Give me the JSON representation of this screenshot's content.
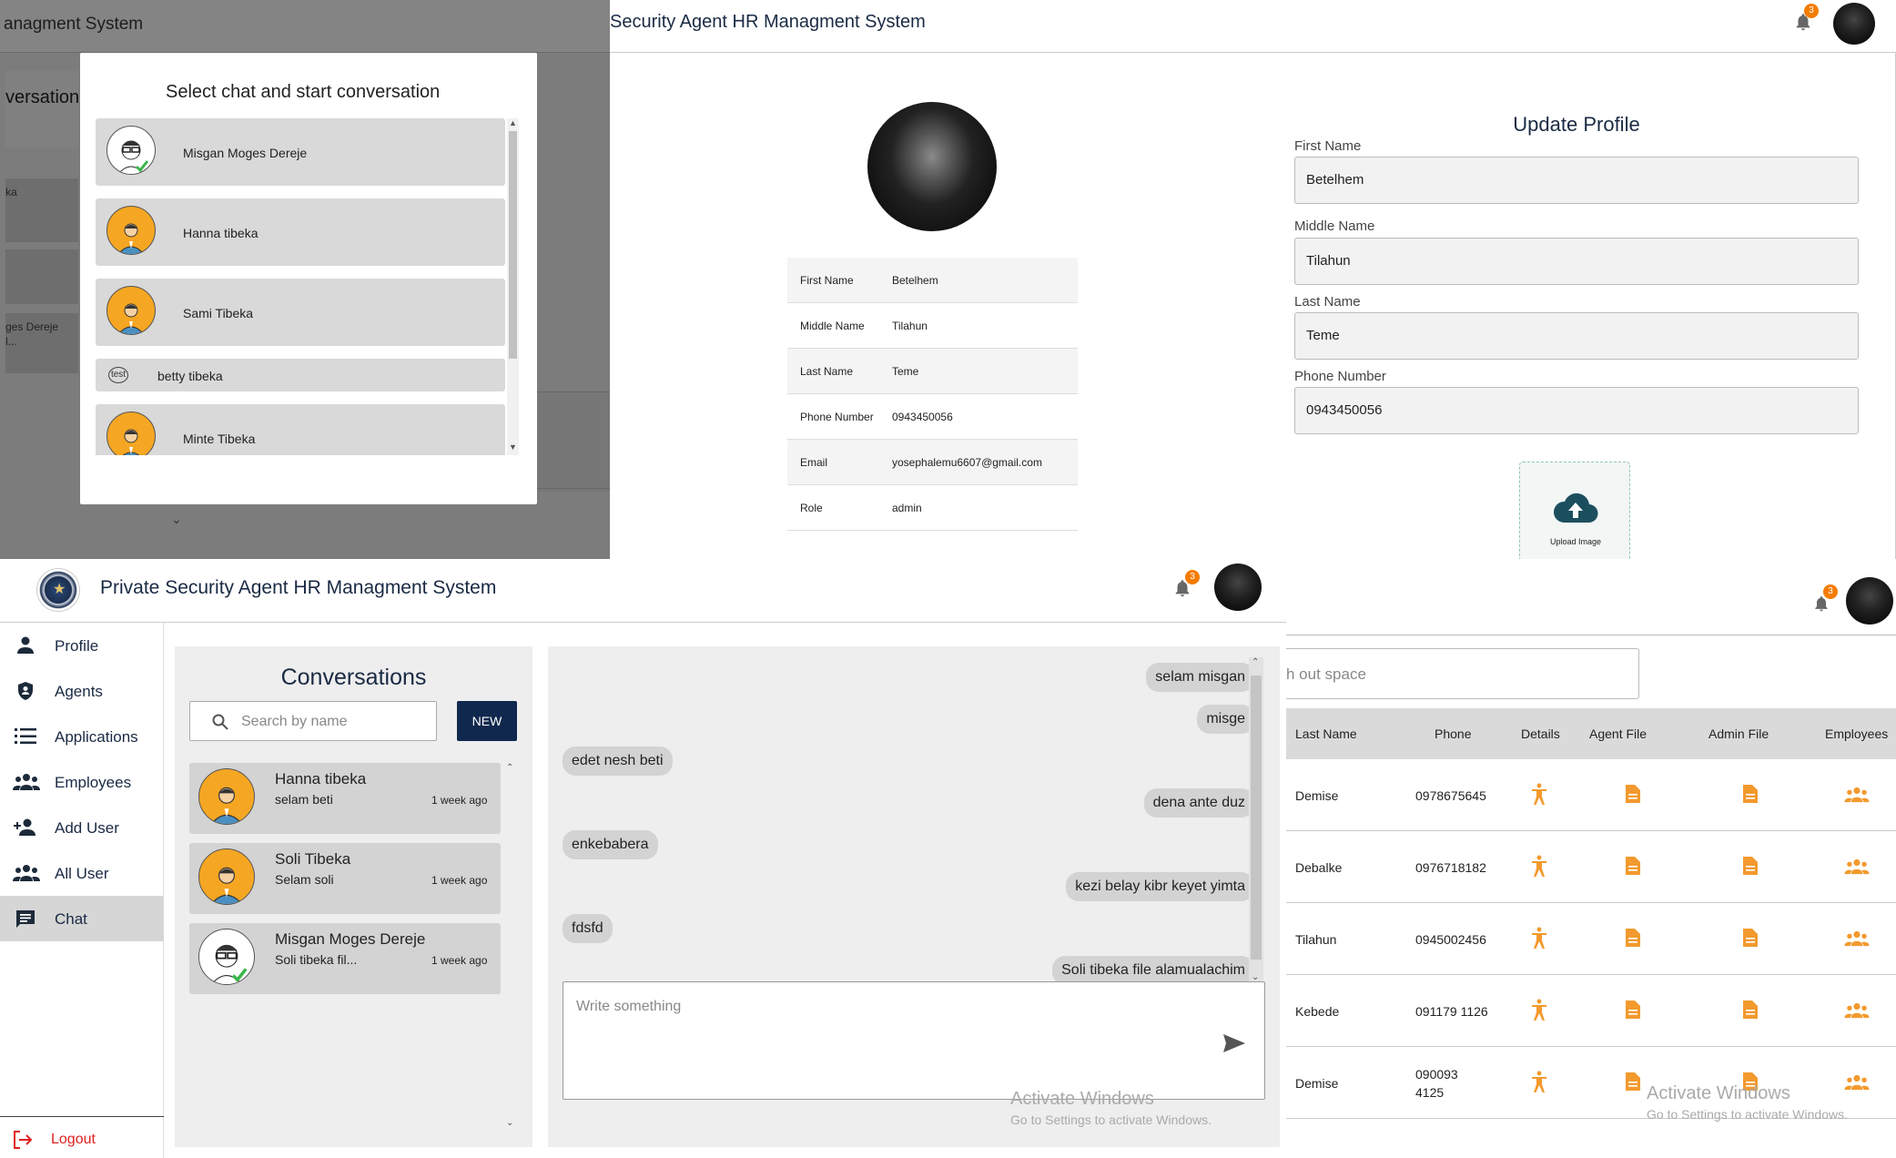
{
  "modal_panel": {
    "bg_title": "anagment System",
    "bg_conv": "versation",
    "bg_item1": "ka",
    "bg_item2": "ges Dereje",
    "bg_item2b": "l...",
    "title": "Select chat and start conversation",
    "chats": [
      {
        "name": "Misgan Moges Dereje",
        "avatar": "nerd-avatar-icon"
      },
      {
        "name": "Hanna tibeka",
        "avatar": "person-avatar-icon"
      },
      {
        "name": "Sami Tibeka",
        "avatar": "person-avatar-icon"
      },
      {
        "name": "betty tibeka",
        "avatar": "broken-image-icon",
        "avatar_text": "test"
      },
      {
        "name": "Minte Tibeka",
        "avatar": "person-avatar-icon"
      }
    ]
  },
  "profile_panel": {
    "app_title": "Security Agent HR Managment System",
    "notif_count": "3",
    "table": [
      {
        "label": "First Name",
        "value": "Betelhem"
      },
      {
        "label": "Middle Name",
        "value": "Tilahun"
      },
      {
        "label": "Last Name",
        "value": "Teme"
      },
      {
        "label": "Phone Number",
        "value": "0943450056"
      },
      {
        "label": "Email",
        "value": "yosephalemu6607@gmail.com"
      },
      {
        "label": "Role",
        "value": "admin"
      }
    ],
    "form": {
      "title": "Update Profile",
      "first_label": "First Name",
      "first_value": "Betelhem",
      "middle_label": "Middle Name",
      "middle_value": "Tilahun",
      "last_label": "Last Name",
      "last_value": "Teme",
      "phone_label": "Phone Number",
      "phone_value": "0943450056",
      "upload_label": "Upload Image"
    }
  },
  "chat_panel": {
    "app_title": "Private Security Agent HR Managment System",
    "notif_count": "3",
    "sidebar": [
      {
        "label": "Profile",
        "icon": "person-icon"
      },
      {
        "label": "Agents",
        "icon": "shield-icon"
      },
      {
        "label": "Applications",
        "icon": "list-icon"
      },
      {
        "label": "Employees",
        "icon": "group-icon"
      },
      {
        "label": "Add User",
        "icon": "person-add-icon"
      },
      {
        "label": "All User",
        "icon": "group-icon"
      },
      {
        "label": "Chat",
        "icon": "chat-icon",
        "active": true
      }
    ],
    "logout": "Logout",
    "conversations_title": "Conversations",
    "search_placeholder": "Search by name",
    "new_button": "NEW",
    "conversations": [
      {
        "name": "Hanna tibeka",
        "last": "selam beti",
        "time": "1 week ago"
      },
      {
        "name": "Soli Tibeka",
        "last": "Selam soli",
        "time": "1 week ago"
      },
      {
        "name": "Misgan Moges Dereje",
        "last": "Soli tibeka fil...",
        "time": "1 week ago"
      }
    ],
    "messages": [
      {
        "text": "selam misgan",
        "side": "right"
      },
      {
        "text": "misge",
        "side": "right"
      },
      {
        "text": "edet nesh beti",
        "side": "left"
      },
      {
        "text": "dena ante duz",
        "side": "right"
      },
      {
        "text": "enkebabera",
        "side": "left"
      },
      {
        "text": "kezi belay kibr keyet yimta",
        "side": "right"
      },
      {
        "text": "fdsfd",
        "side": "left"
      },
      {
        "text": "Soli tibeka file alamualachim",
        "side": "right"
      }
    ],
    "compose_placeholder": "Write something",
    "watermark1": "Activate Windows",
    "watermark2": "Go to Settings to activate Windows."
  },
  "employees_panel": {
    "notif_count": "3",
    "search_value": "h out space",
    "columns": [
      "Last Name",
      "Phone",
      "Details",
      "Agent File",
      "Admin File",
      "Employees"
    ],
    "rows": [
      {
        "last": "Demise",
        "phone": "0978675645"
      },
      {
        "last": "Debalke",
        "phone": "0976718182"
      },
      {
        "last": "Tilahun",
        "phone": "0945002456"
      },
      {
        "last": "Kebede",
        "phone": "091179 1126"
      },
      {
        "last": "Demise",
        "phone": "090093\n4125"
      }
    ],
    "watermark1": "Activate Windows",
    "watermark2": "Go to Settings to activate Windows."
  },
  "colors": {
    "accent": "#f5a623",
    "navy": "#0d2447",
    "orange_icon": "#f29a2e"
  }
}
